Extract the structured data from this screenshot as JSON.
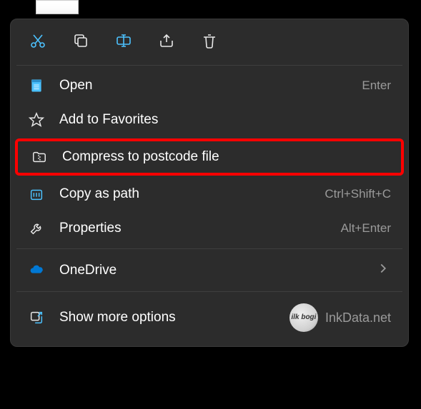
{
  "menu": {
    "items": [
      {
        "label": "Open",
        "shortcut": "Enter"
      },
      {
        "label": "Add to Favorites",
        "shortcut": ""
      },
      {
        "label": "Compress to postcode file",
        "shortcut": ""
      },
      {
        "label": "Copy as path",
        "shortcut": "Ctrl+Shift+C"
      },
      {
        "label": "Properties",
        "shortcut": "Alt+Enter"
      },
      {
        "label": "OneDrive",
        "shortcut": ""
      },
      {
        "label": "Show more options",
        "shortcut": ""
      }
    ]
  },
  "watermark": {
    "logo_text": "ilk bogi",
    "site": "InkData.net"
  }
}
